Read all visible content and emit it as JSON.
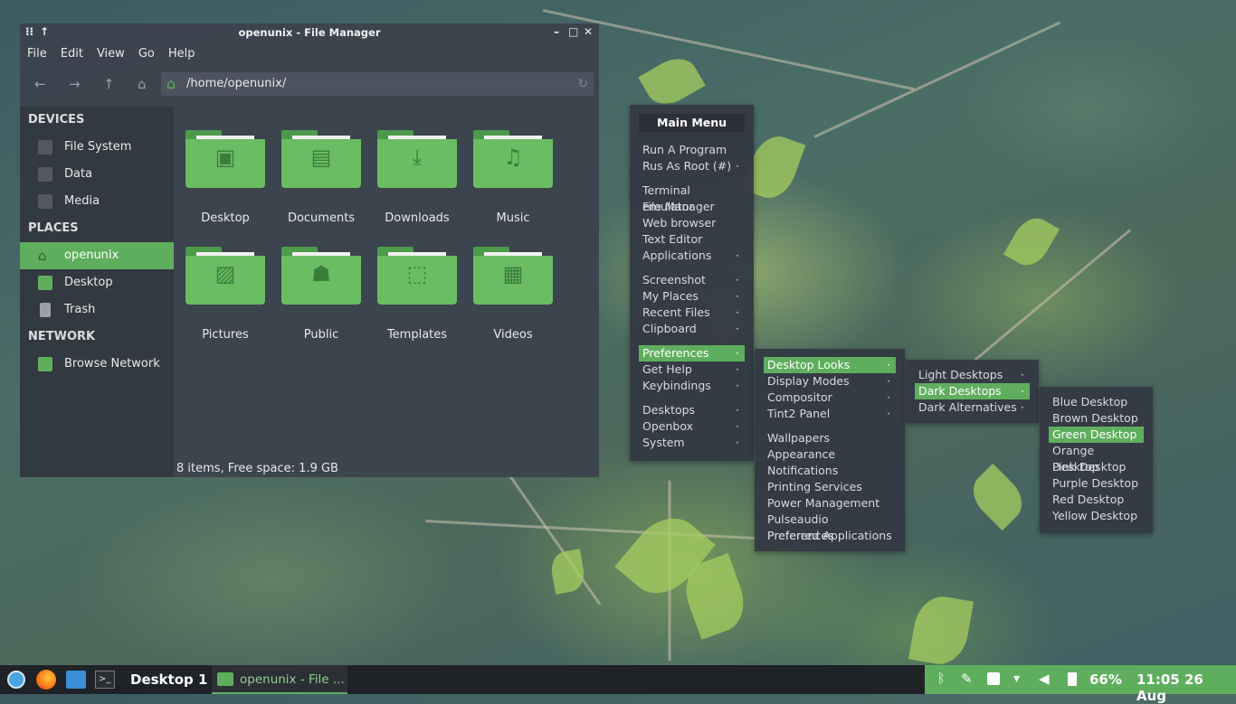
{
  "window": {
    "title": "openunix - File Manager",
    "menu": [
      "File",
      "Edit",
      "View",
      "Go",
      "Help"
    ],
    "path": "/home/openunix/",
    "sidebar": {
      "devices_heading": "DEVICES",
      "devices": [
        "File System",
        "Data",
        "Media"
      ],
      "places_heading": "PLACES",
      "places": [
        "openunix",
        "Desktop",
        "Trash"
      ],
      "network_heading": "NETWORK",
      "network": [
        "Browse Network"
      ]
    },
    "folders": [
      {
        "label": "Desktop",
        "icon": "monitor-icon"
      },
      {
        "label": "Documents",
        "icon": "document-icon"
      },
      {
        "label": "Downloads",
        "icon": "download-icon"
      },
      {
        "label": "Music",
        "icon": "music-icon"
      },
      {
        "label": "Pictures",
        "icon": "picture-icon"
      },
      {
        "label": "Public",
        "icon": "people-icon"
      },
      {
        "label": "Templates",
        "icon": "template-icon"
      },
      {
        "label": "Videos",
        "icon": "film-icon"
      }
    ],
    "status": "8 items, Free space: 1.9 GB"
  },
  "main_menu": {
    "title": "Main Menu",
    "items": [
      "Run A Program",
      "Rus As Root (#)",
      "Terminal emulator",
      "File Manager",
      "Web browser",
      "Text Editor",
      "Applications",
      "Screenshot",
      "My Places",
      "Recent Files",
      "Clipboard",
      "Preferences",
      "Get Help",
      "Keybindings",
      "Desktops",
      "Openbox",
      "System"
    ]
  },
  "preferences_menu": {
    "items": [
      "Desktop Looks",
      "Display Modes",
      "Compositor",
      "Tint2 Panel",
      "Wallpapers",
      "Appearance",
      "Notifications",
      "Printing Services",
      "Power Management",
      "Pulseaudio Preferences",
      "Preferred Applications"
    ]
  },
  "looks_menu": {
    "items": [
      "Light Desktops",
      "Dark Desktops",
      "Dark Alternatives"
    ]
  },
  "dark_menu": {
    "items": [
      "Blue Desktop",
      "Brown Desktop",
      "Green Desktop",
      "Orange Desktop",
      "Pink Desktop",
      "Purple Desktop",
      "Red Desktop",
      "Yellow Desktop"
    ]
  },
  "taskbar": {
    "desktop": "Desktop 1",
    "task": "openunix - File ...",
    "battery": "66%",
    "clock": "11:05 26 Aug"
  },
  "colors": {
    "accent": "#5fae5e",
    "panel": "#1f2226",
    "menu_bg": "#343943"
  }
}
